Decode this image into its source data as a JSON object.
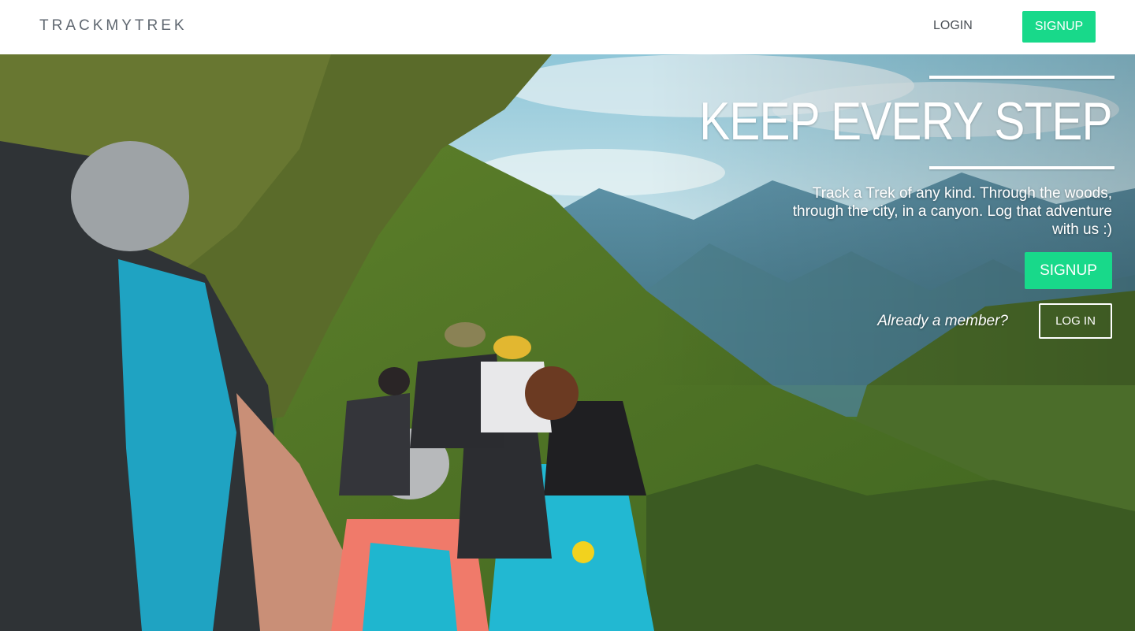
{
  "navbar": {
    "brand": "TRACKMYTREK",
    "login_label": "LOGIN",
    "signup_label": "SIGNUP"
  },
  "hero": {
    "headline": "KEEP EVERY STEP",
    "tagline": "Track a Trek of any kind. Through the woods, through the city, in a canyon. Log that adventure with us :)",
    "signup_label": "SIGNUP",
    "member_prompt": "Already a member?",
    "login_label": "LOG IN",
    "background_image": "hikers-mountain-trail-photo"
  },
  "colors": {
    "accent": "#18d98a",
    "brand_text": "#5f6770",
    "nav_text": "#4a4f55",
    "hero_text": "#ffffff"
  }
}
